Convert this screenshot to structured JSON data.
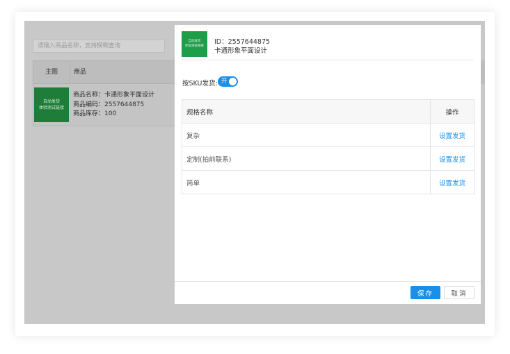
{
  "background_page": {
    "search_placeholder": "请输入商品名称，支持模糊查询",
    "table": {
      "headers": [
        "主图",
        "商品"
      ],
      "row": {
        "thumb_lines": [
          "自动发货",
          "体验测试链接"
        ],
        "name": "商品名称：卡通形象平面设计",
        "code": "商品编码：2557644875",
        "stock": "商品库存：100"
      }
    }
  },
  "modal": {
    "thumb_lines": [
      "自动发货",
      "体验测试链接"
    ],
    "product_id": "ID：2557644875",
    "product_title": "卡通形象平面设计",
    "sku_label": "按SKU发货:",
    "toggle_label": "开",
    "table": {
      "headers": {
        "name": "规格名称",
        "action": "操作"
      },
      "rows": [
        {
          "name": "复杂",
          "action": "设置发货"
        },
        {
          "name": "定制(拍前联系)",
          "action": "设置发货"
        },
        {
          "name": "简单",
          "action": "设置发货"
        }
      ]
    },
    "buttons": {
      "save": "保存",
      "cancel": "取消"
    }
  },
  "colors": {
    "accent": "#1a8fe8",
    "thumb_green": "#1f9e4a",
    "overlay": "#c8c8c8"
  }
}
